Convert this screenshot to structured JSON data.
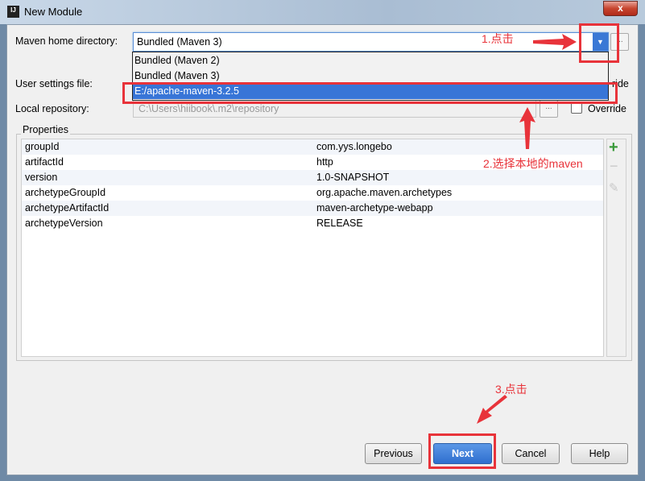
{
  "window": {
    "title": "New Module",
    "close_label": "x"
  },
  "form": {
    "maven_home_label": "Maven home directory:",
    "maven_home_value": "Bundled (Maven 3)",
    "user_settings_label": "User settings file:",
    "user_settings_override_partial": "ride",
    "local_repo_label": "Local repository:",
    "local_repo_value": "C:\\Users\\hiibook\\.m2\\repository",
    "override_label": "Override",
    "browse_label": "..."
  },
  "dropdown": {
    "options": [
      "Bundled (Maven 2)",
      "Bundled (Maven 3)",
      "E:/apache-maven-3.2.5"
    ],
    "selected": "E:/apache-maven-3.2.5"
  },
  "properties": {
    "label": "Properties",
    "rows": [
      {
        "key": "groupId",
        "value": "com.yys.longebo"
      },
      {
        "key": "artifactId",
        "value": "http"
      },
      {
        "key": "version",
        "value": "1.0-SNAPSHOT"
      },
      {
        "key": "archetypeGroupId",
        "value": "org.apache.maven.archetypes"
      },
      {
        "key": "archetypeArtifactId",
        "value": "maven-archetype-webapp"
      },
      {
        "key": "archetypeVersion",
        "value": "RELEASE"
      }
    ],
    "add": "+",
    "remove": "−",
    "edit": "✎"
  },
  "buttons": {
    "previous": "Previous",
    "next": "Next",
    "cancel": "Cancel",
    "help": "Help"
  },
  "annotations": {
    "step1": "1.点击",
    "step2": "2.选择本地的maven",
    "step3": "3.点击",
    "color": "#e8333a"
  }
}
